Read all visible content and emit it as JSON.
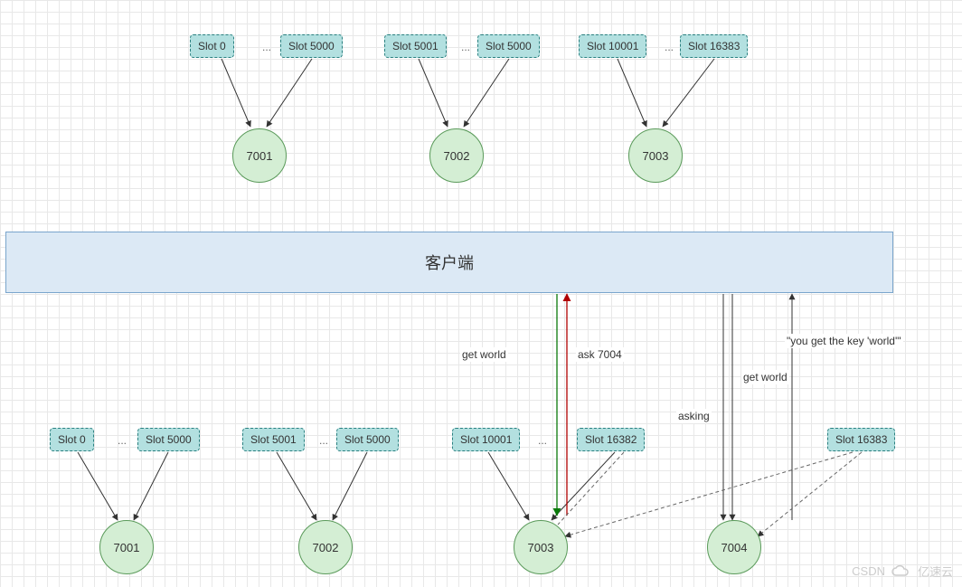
{
  "top": {
    "group1": {
      "slotA": "Slot 0",
      "slotB": "Slot 5000",
      "node": "7001"
    },
    "group2": {
      "slotA": "Slot 5001",
      "slotB": "Slot 5000",
      "node": "7002"
    },
    "group3": {
      "slotA": "Slot 10001",
      "slotB": "Slot 16383",
      "node": "7003"
    }
  },
  "client": {
    "label": "客户端"
  },
  "bottom": {
    "group1": {
      "slotA": "Slot 0",
      "slotB": "Slot 5000",
      "node": "7001"
    },
    "group2": {
      "slotA": "Slot 5001",
      "slotB": "Slot 5000",
      "node": "7002"
    },
    "group3": {
      "slotA": "Slot 10001",
      "slotB": "Slot 16382",
      "node": "7003"
    },
    "group4": {
      "slotA": "Slot 16383",
      "node": "7004"
    }
  },
  "labels": {
    "get_world_1": "get world",
    "ask_7004": "ask 7004",
    "asking": "asking",
    "get_world_2": "get world",
    "you_get": "\"you get the key 'world'\""
  },
  "dots": "...",
  "watermark": {
    "csdn": "CSDN",
    "yisu": "亿速云"
  }
}
